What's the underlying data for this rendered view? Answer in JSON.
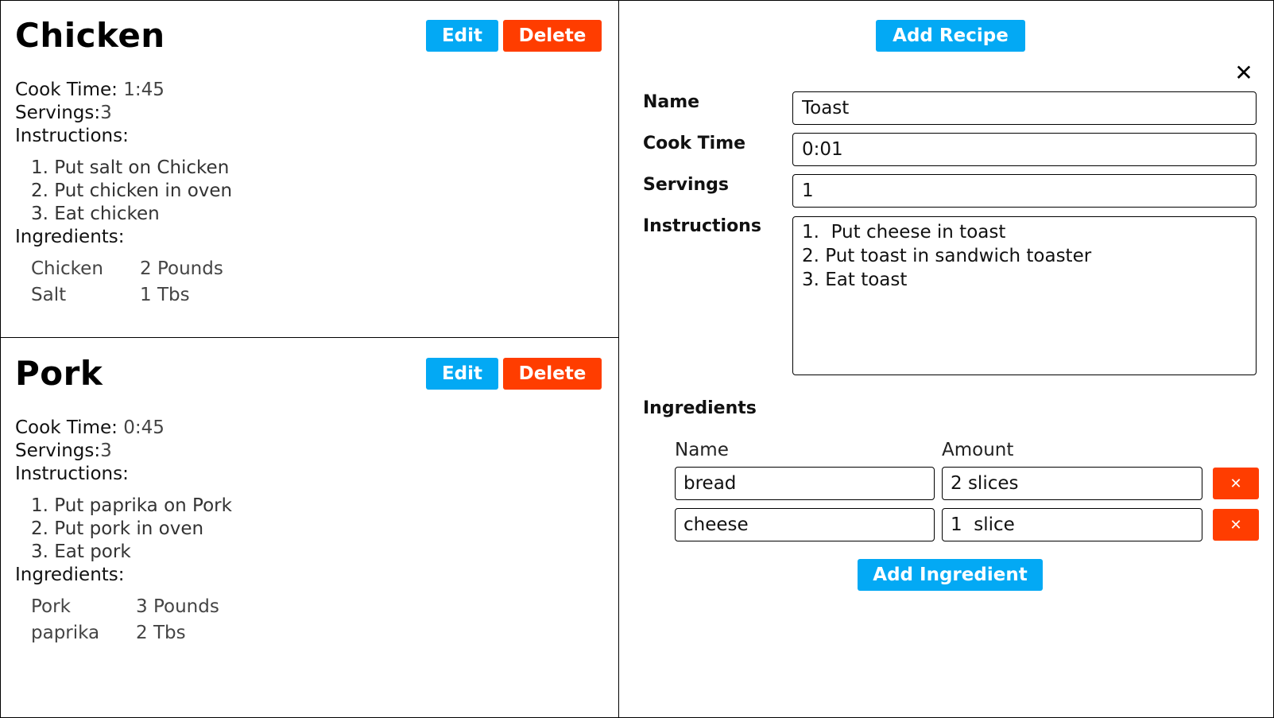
{
  "recipes": [
    {
      "title": "Chicken",
      "edit_label": "Edit",
      "delete_label": "Delete",
      "cook_time_label": "Cook Time:",
      "cook_time": "1:45",
      "servings_label": "Servings:",
      "servings": "3",
      "instructions_label": "Instructions:",
      "instructions": [
        "1.  Put salt on Chicken",
        "2. Put chicken in oven",
        "3. Eat chicken"
      ],
      "ingredients_label": "Ingredients:",
      "ingredients": [
        {
          "name": "Chicken",
          "amount": "2 Pounds"
        },
        {
          "name": "Salt",
          "amount": "1 Tbs"
        }
      ]
    },
    {
      "title": "Pork",
      "edit_label": "Edit",
      "delete_label": "Delete",
      "cook_time_label": "Cook Time:",
      "cook_time": "0:45",
      "servings_label": "Servings:",
      "servings": "3",
      "instructions_label": "Instructions:",
      "instructions": [
        "1.  Put paprika on Pork",
        "2. Put pork in oven",
        "3. Eat pork"
      ],
      "ingredients_label": "Ingredients:",
      "ingredients": [
        {
          "name": "Pork",
          "amount": "3 Pounds"
        },
        {
          "name": "paprika",
          "amount": "2 Tbs"
        }
      ]
    }
  ],
  "form": {
    "add_recipe_label": "Add Recipe",
    "close_symbol": "✕",
    "name_label": "Name",
    "name_value": "Toast",
    "cook_time_label": "Cook Time",
    "cook_time_value": "0:01",
    "servings_label": "Servings",
    "servings_value": "1",
    "instructions_label": "Instructions",
    "instructions_value": "1.  Put cheese in toast\n2. Put toast in sandwich toaster\n3. Eat toast",
    "ingredients_label": "Ingredients",
    "ingredient_name_header": "Name",
    "ingredient_amount_header": "Amount",
    "ingredients": [
      {
        "name": "bread",
        "amount": "2 slices"
      },
      {
        "name": "cheese",
        "amount": "1  slice"
      }
    ],
    "remove_symbol": "✕",
    "add_ingredient_label": "Add Ingredient"
  },
  "colors": {
    "primary": "#03a9f4",
    "danger": "#ff3d00"
  }
}
